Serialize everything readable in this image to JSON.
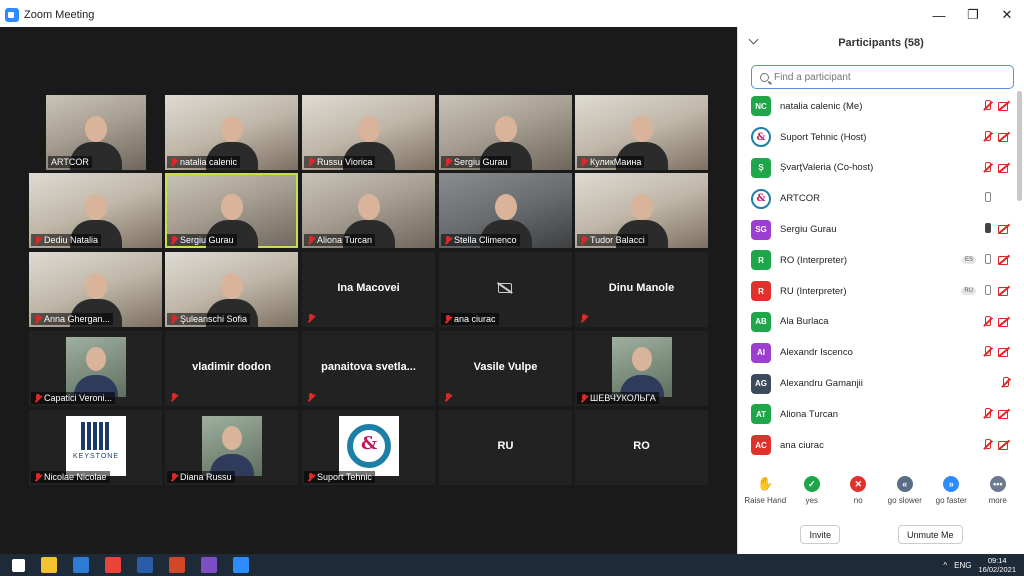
{
  "window": {
    "title": "Zoom Meeting",
    "controls": {
      "minimize": "—",
      "restore": "❐",
      "close": "✕"
    }
  },
  "tiles": [
    {
      "label": "ARTCOR",
      "kind": "cam",
      "muted": false
    },
    {
      "label": "natalia calenic",
      "kind": "cam2",
      "muted": true
    },
    {
      "label": "Russu Viorica",
      "kind": "cam2",
      "muted": true
    },
    {
      "label": "Sergiu Gurau",
      "kind": "cam",
      "muted": true
    },
    {
      "label": "КуликМаина",
      "kind": "cam2",
      "muted": true
    },
    {
      "label": "Dediu Natalia",
      "kind": "cam2",
      "muted": true
    },
    {
      "label": "Sergiu Gurau",
      "kind": "cam",
      "muted": true
    },
    {
      "label": "Aliona Turcan",
      "kind": "cam",
      "muted": true
    },
    {
      "label": "Stella Climenco",
      "kind": "cam3",
      "muted": true
    },
    {
      "label": "Tudor Balacci",
      "kind": "cam2",
      "muted": true
    },
    {
      "label": "Anna Ghergan...",
      "kind": "cam2",
      "muted": true
    },
    {
      "label": "Şuleanschi Sofia",
      "kind": "cam2",
      "muted": true
    },
    {
      "label": "Ina Macovei",
      "kind": "name",
      "muted": true
    },
    {
      "label": "ana ciurac",
      "kind": "camoff",
      "muted": true
    },
    {
      "label": "Dinu Manole",
      "kind": "name",
      "muted": true
    },
    {
      "label": "Capatici Veroni...",
      "kind": "photo",
      "muted": true
    },
    {
      "label": "vladimir dodon",
      "kind": "name",
      "muted": true
    },
    {
      "label": "panaitova svetla...",
      "kind": "name",
      "muted": true
    },
    {
      "label": "Vasile Vulpe",
      "kind": "name",
      "muted": true
    },
    {
      "label": "ШЕВЧУКОЛЬГА",
      "kind": "photo",
      "muted": true
    },
    {
      "label": "Nicolae Nicolae",
      "kind": "keystone",
      "muted": true
    },
    {
      "label": "Diana Russu",
      "kind": "photo",
      "muted": true
    },
    {
      "label": "Suport Tehnic",
      "kind": "amp",
      "muted": true
    },
    {
      "label": "RU",
      "kind": "name",
      "muted": false
    },
    {
      "label": "RO",
      "kind": "name",
      "muted": false
    }
  ],
  "keystone": {
    "text": "KEYSTONE"
  },
  "amp_glyph": "&",
  "participants": {
    "title": "Participants (58)",
    "search_placeholder": "Find a participant",
    "list": [
      {
        "initials": "NC",
        "color": "#1fa64a",
        "name": "natalia calenic (Me)",
        "mic": "off",
        "video": "off",
        "badge": ""
      },
      {
        "initials": "&",
        "color": "logo",
        "name": "Suport Tehnic (Host)",
        "mic": "off",
        "video": "off",
        "badge": ""
      },
      {
        "initials": "Ş",
        "color": "#1fa64a",
        "name": "ŞvarţValeria (Co-host)",
        "mic": "off",
        "video": "off",
        "badge": ""
      },
      {
        "initials": "&",
        "color": "logo",
        "name": "ARTCOR",
        "mic": "on",
        "video": "on",
        "badge": ""
      },
      {
        "initials": "SG",
        "color": "#9b3fd0",
        "name": "Sergiu Gurau",
        "mic": "live",
        "video": "off",
        "badge": ""
      },
      {
        "initials": "R",
        "color": "#1fa64a",
        "name": "RO (Interpreter)",
        "mic": "on",
        "video": "off",
        "badge": "ES"
      },
      {
        "initials": "R",
        "color": "#e0322d",
        "name": "RU (Interpreter)",
        "mic": "on",
        "video": "off",
        "badge": "RU"
      },
      {
        "initials": "AB",
        "color": "#1fa64a",
        "name": "Ala Burlaca",
        "mic": "off",
        "video": "off",
        "badge": ""
      },
      {
        "initials": "AI",
        "color": "#9b3fd0",
        "name": "Alexandr Iscenco",
        "mic": "off",
        "video": "off",
        "badge": ""
      },
      {
        "initials": "AG",
        "color": "#3c4b5c",
        "name": "Alexandru Gamanjii",
        "mic": "off",
        "video": "none",
        "badge": ""
      },
      {
        "initials": "AT",
        "color": "#1fa64a",
        "name": "Aliona Turcan",
        "mic": "off",
        "video": "off",
        "badge": ""
      },
      {
        "initials": "AC",
        "color": "#e0322d",
        "name": "ana ciurac",
        "mic": "off",
        "video": "off",
        "badge": ""
      }
    ]
  },
  "reactions": [
    {
      "label": "Raise Hand",
      "glyph": "✋",
      "color": "#2d8cff"
    },
    {
      "label": "yes",
      "glyph": "✓",
      "color": "#1fa64a"
    },
    {
      "label": "no",
      "glyph": "✕",
      "color": "#e0322d"
    },
    {
      "label": "go slower",
      "glyph": "«",
      "color": "#5a6d85"
    },
    {
      "label": "go faster",
      "glyph": "»",
      "color": "#2d8cff"
    },
    {
      "label": "more",
      "glyph": "•••",
      "color": "#6b7a8c"
    }
  ],
  "buttons": {
    "invite": "Invite",
    "unmute": "Unmute Me"
  },
  "taskbar": {
    "lang": "ENG",
    "time": "09:14",
    "date": "16/02/2021",
    "chevron": "^",
    "apps": [
      {
        "name": "windows-start-icon",
        "color": "#ffffff"
      },
      {
        "name": "file-explorer-icon",
        "color": "#f2c233"
      },
      {
        "name": "edge-icon",
        "color": "#2c7cd6"
      },
      {
        "name": "chrome-icon",
        "color": "#e8443a"
      },
      {
        "name": "word-icon",
        "color": "#2b5ca8"
      },
      {
        "name": "powerpoint-icon",
        "color": "#d24726"
      },
      {
        "name": "viber-icon",
        "color": "#7d4fc4"
      },
      {
        "name": "zoom-icon",
        "color": "#2d8cff"
      }
    ]
  }
}
